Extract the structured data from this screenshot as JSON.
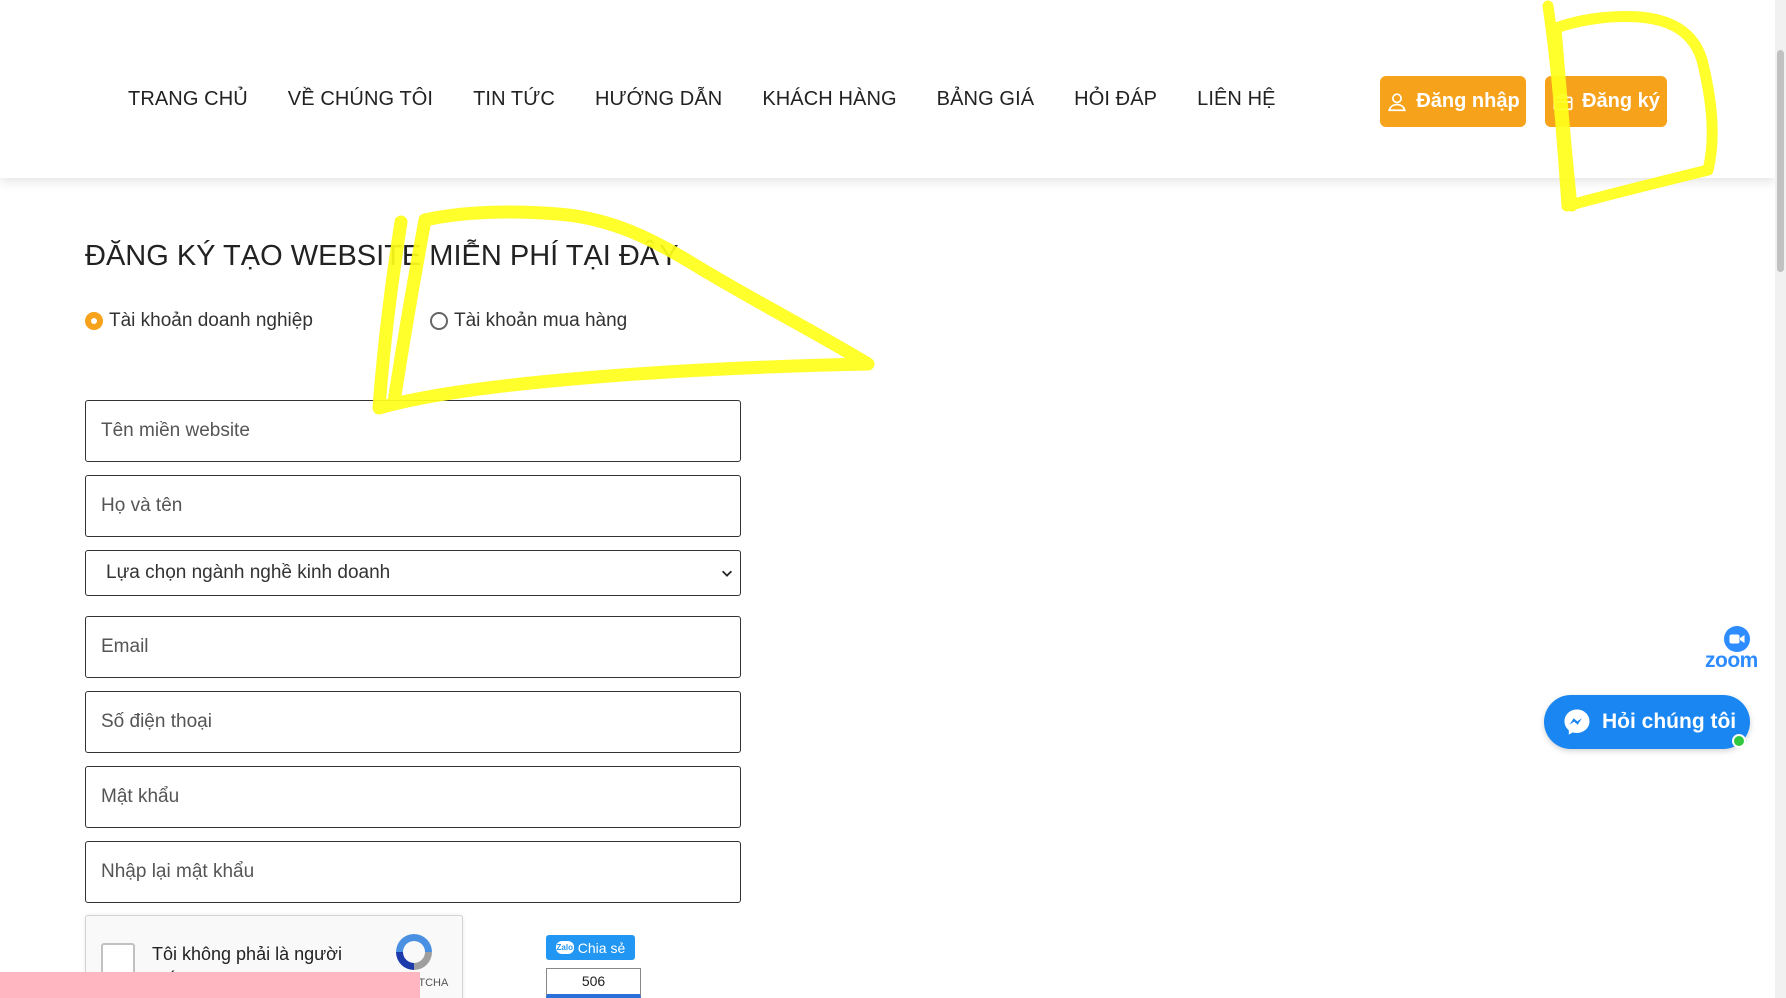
{
  "nav": {
    "items": [
      {
        "label": "TRANG CHỦ"
      },
      {
        "label": "VỀ CHÚNG TÔI"
      },
      {
        "label": "TIN TỨC"
      },
      {
        "label": "HƯỚNG DẪN"
      },
      {
        "label": "KHÁCH HÀNG"
      },
      {
        "label": "BẢNG GIÁ"
      },
      {
        "label": "HỎI ĐÁP"
      },
      {
        "label": "LIÊN HỆ"
      }
    ],
    "login_label": "Đăng nhập",
    "register_label": "Đăng ký"
  },
  "form": {
    "title": "ĐĂNG KÝ TẠO WEBSITE MIỄN PHÍ TẠI ĐÂY",
    "account_types": [
      {
        "label": "Tài khoản doanh nghiệp",
        "checked": true
      },
      {
        "label": "Tài khoản mua hàng",
        "checked": false
      }
    ],
    "fields": {
      "domain": "Tên miền website",
      "fullname": "Họ và tên",
      "industry": "Lựa chọn ngành nghề kinh doanh",
      "email": "Email",
      "phone": "Số điện thoại",
      "password": "Mật khẩu",
      "confirm_password": "Nhập lại mật khẩu"
    },
    "captcha": {
      "text": "Tôi không phải là người máy",
      "brand": "reCAPTCHA"
    }
  },
  "share": {
    "label": "Chia sẻ",
    "count": "506",
    "zalo_text": "Zalo"
  },
  "widgets": {
    "zoom_label": "zoom",
    "chat_label": "Hỏi chúng tôi"
  },
  "colors": {
    "accent": "#f7a21b",
    "highlighter": "#ffff1a",
    "chat_blue": "#1a86f2",
    "zoom_blue": "#2d8cff",
    "pink_bar": "#ffb6c1"
  },
  "icons": {
    "login": "user-icon",
    "register": "briefcase-icon",
    "select": "chevron-down-icon",
    "chat": "messenger-icon",
    "zoom": "camera-icon",
    "captcha": "recaptcha-icon"
  }
}
